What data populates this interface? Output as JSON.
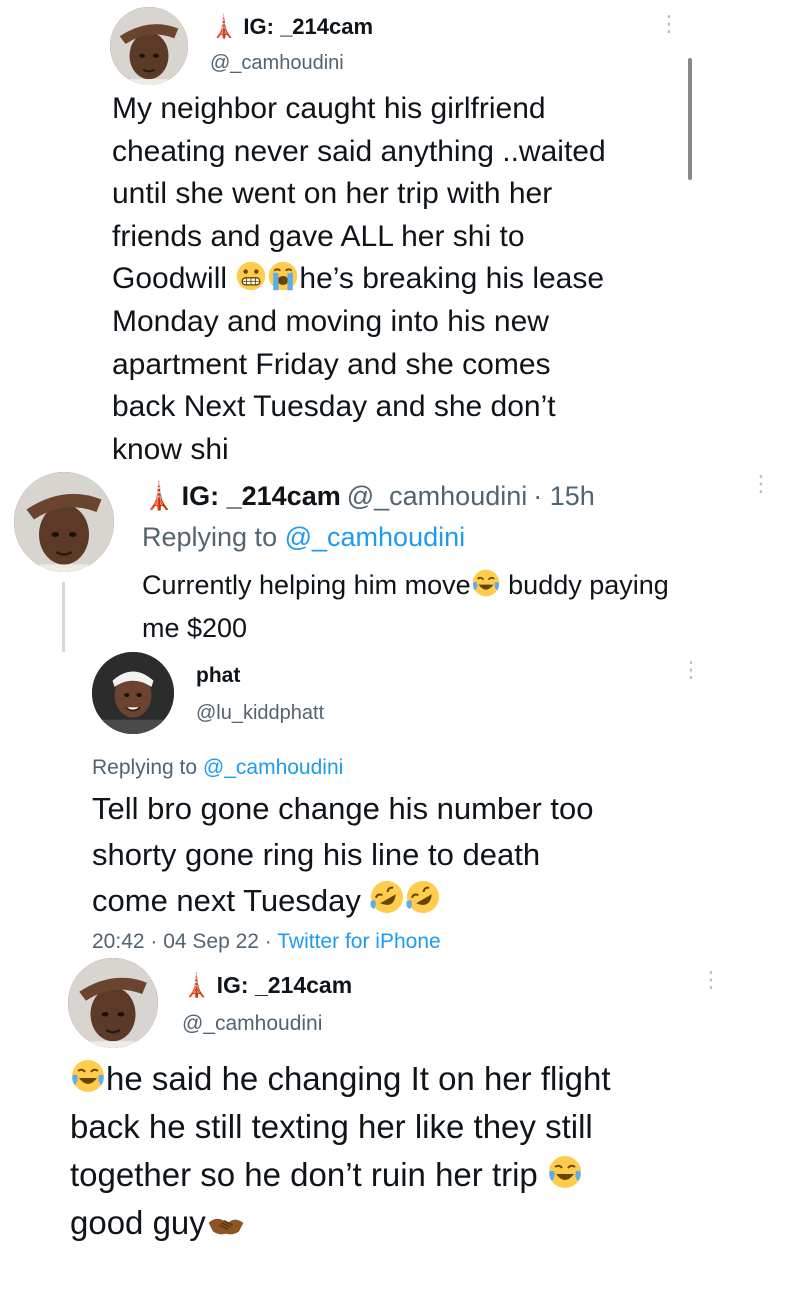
{
  "tweet1": {
    "display_name": "IG: _214cam",
    "handle": "@_camhoudini",
    "body_lines": [
      "My neighbor caught his girlfriend",
      "cheating never said anything ..waited",
      "until she went on her trip with her",
      "friends and gave ALL her shi to",
      "he’s breaking his lease",
      "Monday and moving into his new",
      "apartment Friday and she comes",
      "back Next Tuesday and she don’t",
      "know shi"
    ],
    "goodwill_word": "Goodwill",
    "emojis_line5": [
      "grimacing-face",
      "loudly-crying-face"
    ]
  },
  "tweet2": {
    "display_name": "IG: _214cam",
    "handle": "@_camhoudini",
    "time": "· 15h",
    "replying_prefix": "Replying to",
    "replying_handle": "@_camhoudini",
    "body_line1_a": "Currently helping him move",
    "body_line1_b": "buddy paying",
    "body_line2": "me $200"
  },
  "tweet3": {
    "display_name": "phat",
    "handle": "@lu_kiddphatt",
    "replying_prefix": "Replying to",
    "replying_handle": "@_camhoudini",
    "body_lines": [
      "Tell bro gone change his number too",
      "shorty gone ring his line  to death",
      "come next Tuesday"
    ],
    "meta_time": "20:42 · 04 Sep 22 ·",
    "meta_source": "Twitter for iPhone"
  },
  "tweet4": {
    "display_name": "IG: _214cam",
    "handle": "@_camhoudini",
    "body_line1": "he said he changing It on her flight",
    "body_line2": "back he still texting her like they still",
    "body_line3": "together so he don’t ruin her trip",
    "body_line4": "good guy"
  },
  "colors": {
    "text": "#0f1419",
    "muted": "#536471",
    "link": "#1d9bf0",
    "tower": "#d9322f"
  }
}
